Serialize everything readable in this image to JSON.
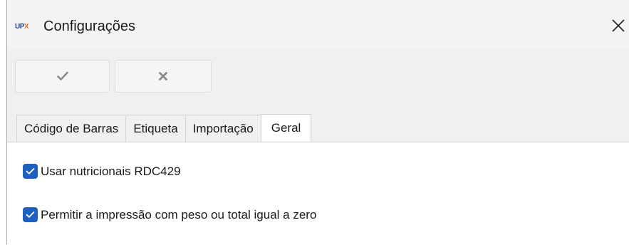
{
  "window": {
    "app_logo": {
      "main": "UP",
      "accent": "X"
    },
    "title": "Configurações",
    "close_glyph": "✕"
  },
  "toolbar": {
    "confirm": {
      "icon": "checkmark-icon",
      "glyph": "✔"
    },
    "cancel": {
      "icon": "x-icon",
      "glyph": "✖"
    }
  },
  "tabs": [
    {
      "label": "Código de Barras",
      "active": false
    },
    {
      "label": "Etiqueta",
      "active": false
    },
    {
      "label": "Importação",
      "active": false
    },
    {
      "label": "Geral",
      "active": true
    }
  ],
  "general": {
    "options": [
      {
        "label": "Usar nutricionais RDC429",
        "checked": true
      },
      {
        "label": "Permitir a impressão com peso ou total igual a zero",
        "checked": true
      }
    ]
  },
  "colors": {
    "accent": "#1f5fbf",
    "window_bg": "#f0f0f0",
    "panel_bg": "#ffffff",
    "logo_blue": "#1b3f8f",
    "logo_orange": "#e8702a"
  }
}
